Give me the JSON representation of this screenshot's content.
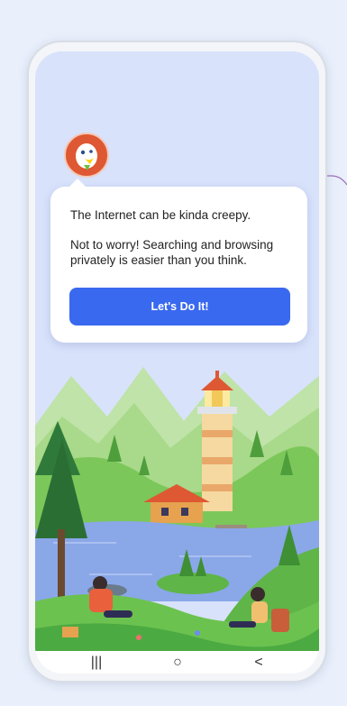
{
  "onboarding": {
    "message_line1": "The Internet can be kinda creepy.",
    "message_line2": "Not to worry! Searching and browsing privately is easier than you think.",
    "cta_label": "Let's Do It!"
  },
  "navbar": {
    "recents_glyph": "|||",
    "home_glyph": "○",
    "back_glyph": "<"
  },
  "colors": {
    "accent": "#3969ef",
    "logo": "#de5833"
  },
  "icons": [
    "duckduckgo-logo",
    "recents-icon",
    "home-icon",
    "back-icon"
  ]
}
